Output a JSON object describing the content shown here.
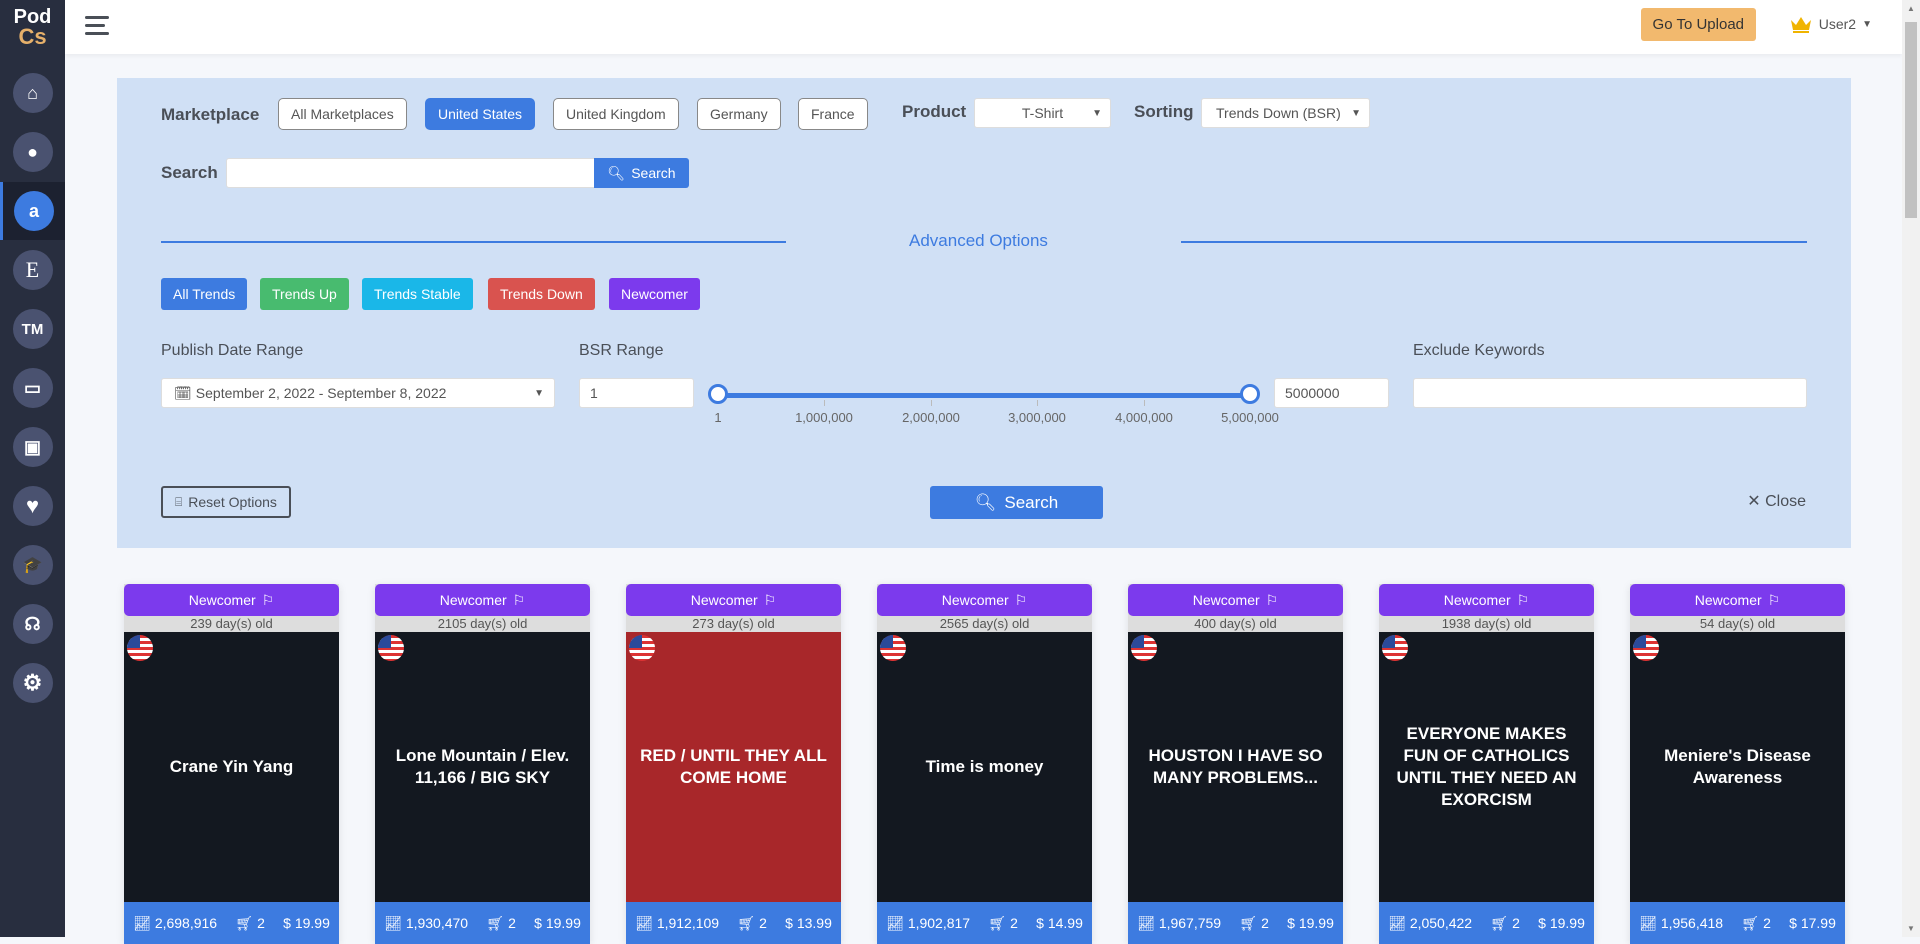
{
  "app": {
    "logo_line1": "Pod",
    "logo_line2": "Cs"
  },
  "sidebar": {
    "items": [
      {
        "name": "home",
        "glyph": "⌂"
      },
      {
        "name": "redbubble",
        "glyph": "●"
      },
      {
        "name": "amazon",
        "glyph": "a",
        "active": true
      },
      {
        "name": "etsy",
        "glyph": "E"
      },
      {
        "name": "trademark",
        "glyph": "TM"
      },
      {
        "name": "calendar",
        "glyph": "▭"
      },
      {
        "name": "toolbox",
        "glyph": "▣"
      },
      {
        "name": "favorites",
        "glyph": "♥"
      },
      {
        "name": "academy",
        "glyph": "🎓"
      },
      {
        "name": "support",
        "glyph": "☊"
      },
      {
        "name": "settings",
        "glyph": "⚙"
      }
    ]
  },
  "topbar": {
    "upload_label": "Go To Upload",
    "user_name": "User2"
  },
  "filters": {
    "marketplace_label": "Marketplace",
    "marketplaces": [
      "All Marketplaces",
      "United States",
      "United Kingdom",
      "Germany",
      "France"
    ],
    "marketplace_selected": "United States",
    "product_label": "Product",
    "product_value": "T-Shirt",
    "sorting_label": "Sorting",
    "sorting_value": "Trends Down (BSR)",
    "search_label": "Search",
    "search_value": "",
    "search_button": "Search",
    "advanced_title": "Advanced Options",
    "trends": [
      {
        "label": "All Trends",
        "color": "#3d7be0"
      },
      {
        "label": "Trends Up",
        "color": "#48bb6f"
      },
      {
        "label": "Trends Stable",
        "color": "#1ab7e8"
      },
      {
        "label": "Trends Down",
        "color": "#d9534f"
      },
      {
        "label": "Newcomer",
        "color": "#7c3aed"
      }
    ],
    "publish_date_label": "Publish Date Range",
    "publish_date_value": "September 2, 2022 - September 8, 2022",
    "bsr_label": "BSR Range",
    "bsr_min": "1",
    "bsr_max": "5000000",
    "bsr_ticks": [
      "1",
      "1,000,000",
      "2,000,000",
      "3,000,000",
      "4,000,000",
      "5,000,000"
    ],
    "exclude_label": "Exclude Keywords",
    "exclude_value": "",
    "reset_label": "Reset Options",
    "apply_label": "Search",
    "close_label": "Close"
  },
  "products": [
    {
      "badge": "Newcomer",
      "age": "239 day(s) old",
      "bsr": "2,698,916",
      "cart": "2",
      "price": "$ 19.99",
      "design": "Crane Yin Yang",
      "bg": "#131820"
    },
    {
      "badge": "Newcomer",
      "age": "2105 day(s) old",
      "bsr": "1,930,470",
      "cart": "2",
      "price": "$ 19.99",
      "design": "Lone Mountain / Elev. 11,166 / BIG SKY",
      "bg": "#131820"
    },
    {
      "badge": "Newcomer",
      "age": "273 day(s) old",
      "bsr": "1,912,109",
      "cart": "2",
      "price": "$ 13.99",
      "design": "RED / UNTIL THEY ALL COME HOME",
      "bg": "#a8272a"
    },
    {
      "badge": "Newcomer",
      "age": "2565 day(s) old",
      "bsr": "1,902,817",
      "cart": "2",
      "price": "$ 14.99",
      "design": "Time is money",
      "bg": "#131820"
    },
    {
      "badge": "Newcomer",
      "age": "400 day(s) old",
      "bsr": "1,967,759",
      "cart": "2",
      "price": "$ 19.99",
      "design": "HOUSTON I HAVE SO MANY PROBLEMS...",
      "bg": "#131820"
    },
    {
      "badge": "Newcomer",
      "age": "1938 day(s) old",
      "bsr": "2,050,422",
      "cart": "2",
      "price": "$ 19.99",
      "design": "EVERYONE MAKES FUN OF CATHOLICS UNTIL THEY NEED AN EXORCISM",
      "bg": "#131820"
    },
    {
      "badge": "Newcomer",
      "age": "54 day(s) old",
      "bsr": "1,956,418",
      "cart": "2",
      "price": "$ 17.99",
      "design": "Meniere's Disease Awareness",
      "bg": "#131820"
    }
  ]
}
